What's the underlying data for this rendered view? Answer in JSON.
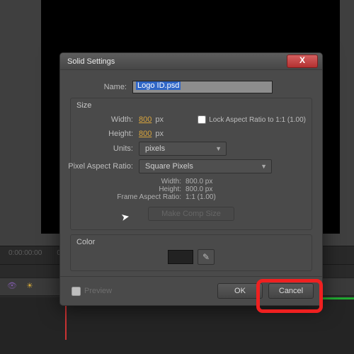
{
  "app": {
    "tc": "0:00:00:00"
  },
  "dialog": {
    "title": "Solid Settings",
    "close": "X",
    "name_label": "Name:",
    "name_value": "Logo ID.psd",
    "size": {
      "section": "Size",
      "width_label": "Width:",
      "width_value": "800",
      "height_label": "Height:",
      "height_value": "800",
      "px": "px",
      "lock_label": "Lock Aspect Ratio to 1:1 (1.00)",
      "units_label": "Units:",
      "units_value": "pixels",
      "par_label": "Pixel Aspect Ratio:",
      "par_value": "Square Pixels",
      "info_width_k": "Width:",
      "info_width_v": "800.0 px",
      "info_height_k": "Height:",
      "info_height_v": "800.0 px",
      "info_far_k": "Frame Aspect Ratio:",
      "info_far_v": "1:1 (1.00)",
      "make_comp": "Make Comp Size"
    },
    "color_section": "Color",
    "preview": "Preview",
    "ok": "OK",
    "cancel": "Cancel"
  }
}
